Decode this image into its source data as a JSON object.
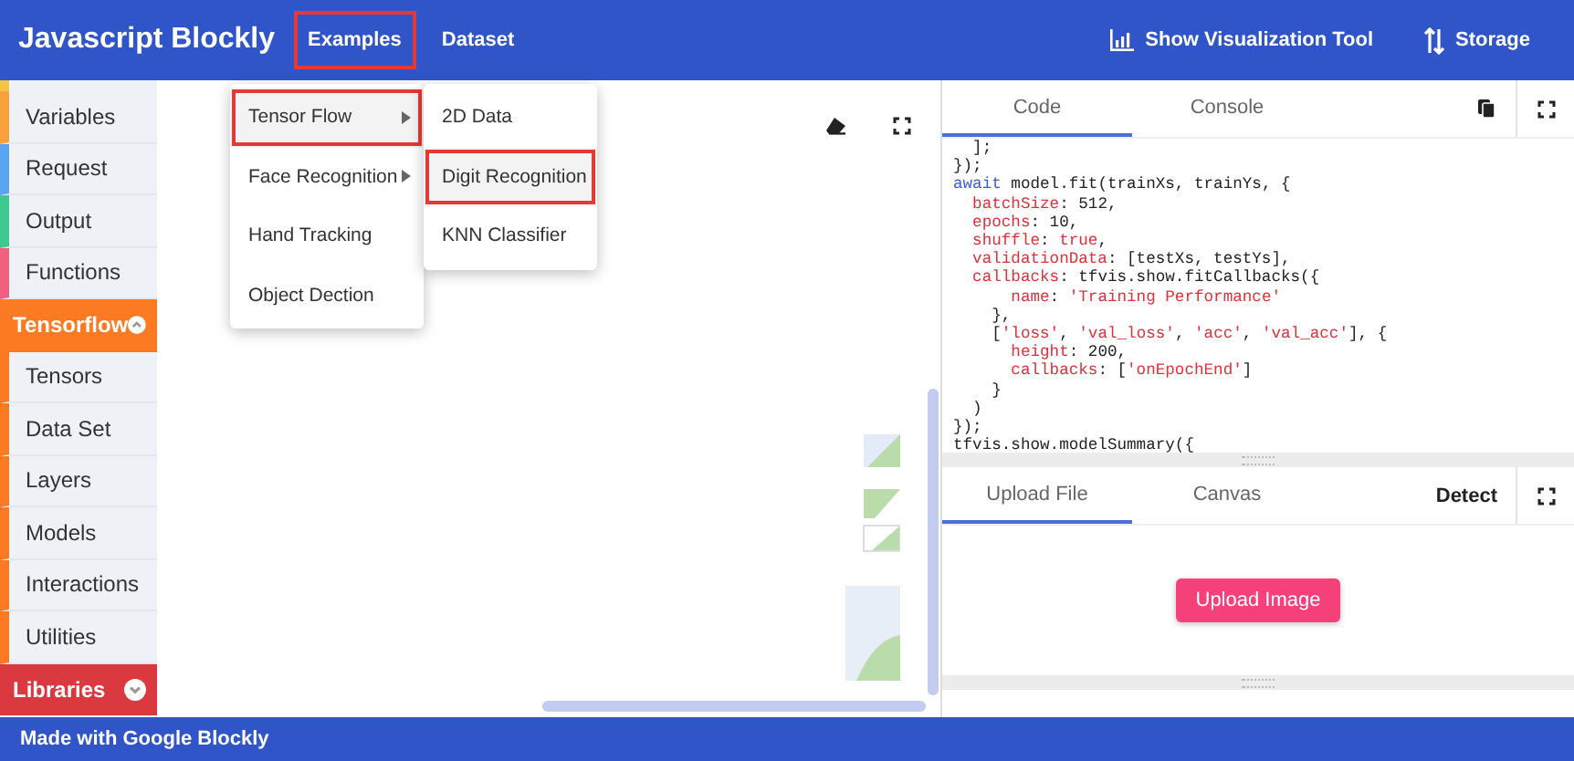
{
  "header": {
    "title": "Javascript Blockly",
    "nav": [
      {
        "label": "Examples",
        "highlighted": true
      },
      {
        "label": "Dataset",
        "highlighted": false
      }
    ],
    "actions": [
      {
        "kind": "chart",
        "label": "Show Visualization Tool"
      },
      {
        "kind": "sort",
        "label": "Storage"
      }
    ]
  },
  "examples_menu": {
    "items": [
      {
        "label": "Tensor Flow",
        "has_submenu": true,
        "selected": true,
        "highlighted": true
      },
      {
        "label": "Face Recognition",
        "has_submenu": true,
        "selected": false,
        "highlighted": false
      },
      {
        "label": "Hand Tracking",
        "has_submenu": false,
        "selected": false,
        "highlighted": false
      },
      {
        "label": "Object Dection",
        "has_submenu": false,
        "selected": false,
        "highlighted": false
      }
    ],
    "submenu": [
      {
        "label": "2D Data",
        "selected": false,
        "highlighted": false
      },
      {
        "label": "Digit Recognition",
        "selected": true,
        "highlighted": true
      },
      {
        "label": "KNN Classifier",
        "selected": false,
        "highlighted": false
      }
    ]
  },
  "sidebar": {
    "items": [
      {
        "kind": "category",
        "label": "Variables",
        "color": "#f9a23d"
      },
      {
        "kind": "category",
        "label": "Request",
        "color": "#5ba5f0"
      },
      {
        "kind": "category",
        "label": "Output",
        "color": "#3cc88e"
      },
      {
        "kind": "category",
        "label": "Functions",
        "color": "#f0607f"
      },
      {
        "kind": "group",
        "label": "Tensorflow",
        "color": "#fb7a22",
        "expanded": true,
        "children": [
          {
            "label": "Tensors"
          },
          {
            "label": "Data Set"
          },
          {
            "label": "Layers"
          },
          {
            "label": "Models"
          },
          {
            "label": "Interactions"
          },
          {
            "label": "Utilities"
          }
        ]
      },
      {
        "kind": "group",
        "label": "Libraries",
        "color": "#d9393f",
        "expanded": false
      }
    ]
  },
  "code_panel": {
    "tabs": [
      {
        "label": "Code",
        "selected": true
      },
      {
        "label": "Console",
        "selected": false
      }
    ],
    "lines": [
      [
        {
          "kind": "plain",
          "text": "  ];"
        }
      ],
      [
        {
          "kind": "plain",
          "text": "});"
        }
      ],
      [
        {
          "kind": "keyword",
          "text": "await"
        },
        {
          "kind": "plain",
          "text": " model.fit(trainXs, trainYs, {"
        }
      ],
      [
        {
          "kind": "property",
          "text": "  batchSize"
        },
        {
          "kind": "plain",
          "text": ": 512,"
        }
      ],
      [
        {
          "kind": "property",
          "text": "  epochs"
        },
        {
          "kind": "plain",
          "text": ": 10,"
        }
      ],
      [
        {
          "kind": "property",
          "text": "  shuffle"
        },
        {
          "kind": "plain",
          "text": ": "
        },
        {
          "kind": "property",
          "text": "true"
        },
        {
          "kind": "plain",
          "text": ","
        }
      ],
      [
        {
          "kind": "property",
          "text": "  validationData"
        },
        {
          "kind": "plain",
          "text": ": [testXs, testYs],"
        }
      ],
      [
        {
          "kind": "property",
          "text": "  callbacks"
        },
        {
          "kind": "plain",
          "text": ": tfvis.show.fitCallbacks({"
        }
      ],
      [
        {
          "kind": "property",
          "text": "      name"
        },
        {
          "kind": "plain",
          "text": ": "
        },
        {
          "kind": "string",
          "text": "'Training Performance'"
        }
      ],
      [
        {
          "kind": "plain",
          "text": "    },"
        }
      ],
      [
        {
          "kind": "plain",
          "text": "    ["
        },
        {
          "kind": "string",
          "text": "'loss'"
        },
        {
          "kind": "plain",
          "text": ", "
        },
        {
          "kind": "string",
          "text": "'val_loss'"
        },
        {
          "kind": "plain",
          "text": ", "
        },
        {
          "kind": "string",
          "text": "'acc'"
        },
        {
          "kind": "plain",
          "text": ", "
        },
        {
          "kind": "string",
          "text": "'val_acc'"
        },
        {
          "kind": "plain",
          "text": "], {"
        }
      ],
      [
        {
          "kind": "property",
          "text": "      height"
        },
        {
          "kind": "plain",
          "text": ": 200,"
        }
      ],
      [
        {
          "kind": "property",
          "text": "      callbacks"
        },
        {
          "kind": "plain",
          "text": ": ["
        },
        {
          "kind": "string",
          "text": "'onEpochEnd'"
        },
        {
          "kind": "plain",
          "text": "]"
        }
      ],
      [
        {
          "kind": "plain",
          "text": "    }"
        }
      ],
      [
        {
          "kind": "plain",
          "text": "  )"
        }
      ],
      [
        {
          "kind": "plain",
          "text": "});"
        }
      ],
      [
        {
          "kind": "plain",
          "text": "tfvis.show.modelSummary({"
        }
      ]
    ]
  },
  "image_panel": {
    "tabs": [
      {
        "label": "Upload File",
        "selected": true
      },
      {
        "label": "Canvas",
        "selected": false
      }
    ],
    "detect_label": "Detect",
    "upload_button": "Upload Image"
  },
  "footer": {
    "text": "Made with Google Blockly"
  }
}
